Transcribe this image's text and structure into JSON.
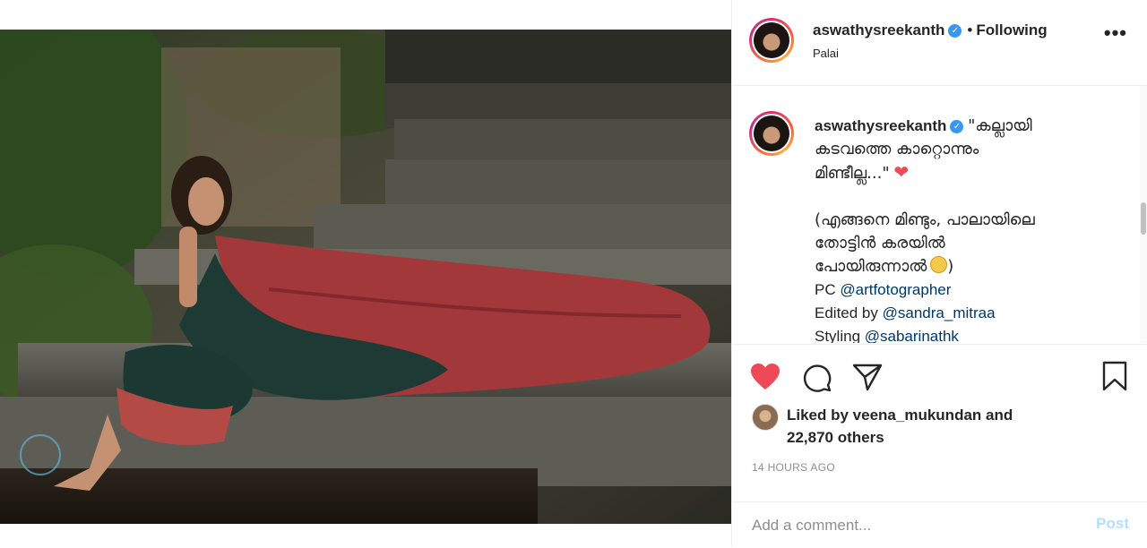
{
  "post": {
    "username": "aswathysreekanth",
    "follow_status": "Following",
    "location": "Palai",
    "caption": {
      "username": "aswathysreekanth",
      "line1": "\"കല്ലായി",
      "line2": "കടവത്തെ കാറ്റൊന്നും",
      "line3": "മിണ്ടീല്ല...\"",
      "line4": "(എങ്ങനെ മിണ്ടും, പാലായിലെ",
      "line5": "തോട്ടിൻ കരയിൽ",
      "line6": "പോയിരുന്നാൽ",
      "credits": [
        {
          "prefix": "PC",
          "handle": "@artfotographer"
        },
        {
          "prefix": "Edited by",
          "handle": "@sandra_mitraa"
        },
        {
          "prefix": "Styling",
          "handle": "@sabarinathk_"
        }
      ]
    },
    "likes_line1": "Liked by veena_mukundan and",
    "likes_line2": "22,870 others",
    "timestamp": "14 HOURS AGO",
    "comment_placeholder": "Add a comment...",
    "post_label": "Post"
  },
  "colors": {
    "heart": "#ed4956",
    "verified": "#3897f0",
    "link": "#00376b",
    "post_disabled": "#b2dffc"
  },
  "icons": {
    "more": "more-options-icon",
    "like": "heart-icon",
    "comment": "comment-icon",
    "share": "paper-plane-icon",
    "save": "bookmark-icon"
  }
}
